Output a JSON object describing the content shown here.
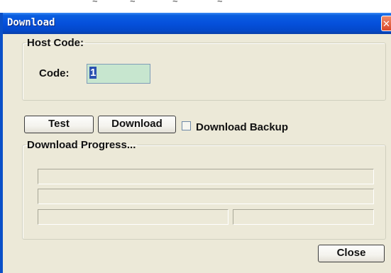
{
  "window": {
    "title": "Download",
    "close_glyph": "✕",
    "accent_color": "#0550dc",
    "background_color": "#ece9d8"
  },
  "host_code": {
    "group_label": "Host Code:",
    "code_label": "Code:",
    "code_value": "1"
  },
  "actions": {
    "test_label": "Test",
    "download_label": "Download",
    "download_backup_label": "Download Backup",
    "download_backup_checked": false
  },
  "progress": {
    "group_label": "Download Progress...",
    "bar1_fraction": 0,
    "bar2_fraction": 0,
    "status_left": "",
    "status_right": ""
  },
  "footer": {
    "close_label": "Close"
  }
}
